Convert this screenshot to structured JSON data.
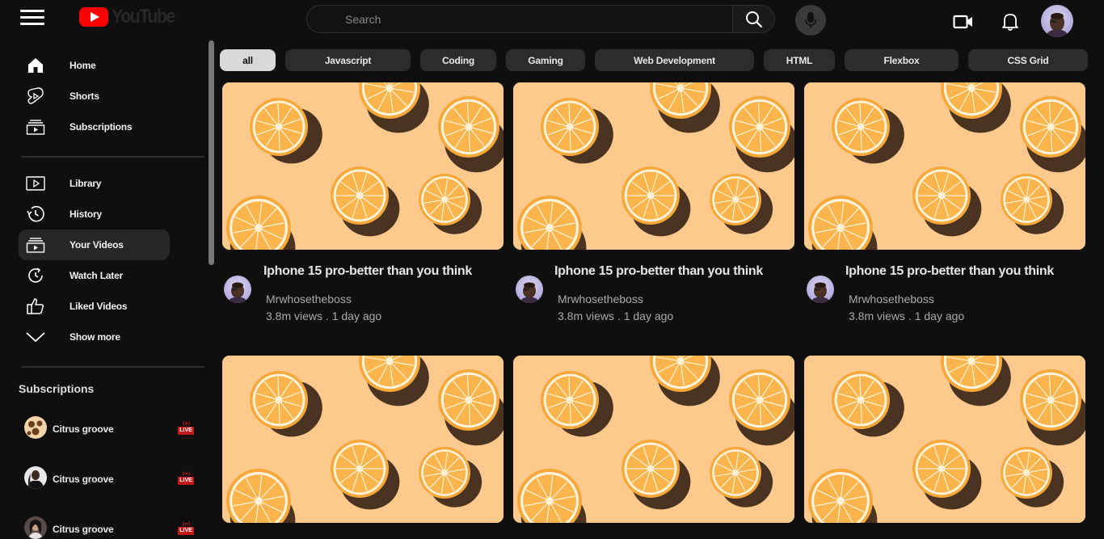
{
  "header": {
    "logo_text": "YouTube",
    "search_placeholder": "Search"
  },
  "sidebar": {
    "main_items": [
      {
        "label": "Home",
        "icon": "home-icon"
      },
      {
        "label": "Shorts",
        "icon": "shorts-icon"
      },
      {
        "label": "Subscriptions",
        "icon": "subscriptions-icon"
      }
    ],
    "library_items": [
      {
        "label": "Library",
        "icon": "library-icon"
      },
      {
        "label": "History",
        "icon": "history-icon"
      },
      {
        "label": "Your Videos",
        "icon": "your-videos-icon",
        "active": true
      },
      {
        "label": "Watch Later",
        "icon": "watch-later-icon"
      },
      {
        "label": "Liked Videos",
        "icon": "thumbs-up-icon"
      },
      {
        "label": "Show more",
        "icon": "chevron-down-icon"
      }
    ],
    "subscriptions_heading": "Subscriptions",
    "subscriptions": [
      {
        "name": "Citrus groove",
        "live": "LIVE"
      },
      {
        "name": "Citrus groove",
        "live": "LIVE"
      },
      {
        "name": "Citrus groove",
        "live": "LIVE"
      }
    ]
  },
  "chips": [
    "all",
    "Javascript",
    "Coding",
    "Gaming",
    "Web Development",
    "HTML",
    "Flexbox",
    "CSS Grid"
  ],
  "videos": [
    {
      "title": "Iphone 15 pro-better than you think",
      "channel": "Mrwhosetheboss",
      "meta": "3.8m views . 1 day ago"
    },
    {
      "title": "Iphone 15 pro-better than you think",
      "channel": "Mrwhosetheboss",
      "meta": "3.8m views . 1 day ago"
    },
    {
      "title": "Iphone 15 pro-better than you think",
      "channel": "Mrwhosetheboss",
      "meta": "3.8m views . 1 day ago"
    },
    {
      "title": "",
      "channel": "",
      "meta": ""
    },
    {
      "title": "",
      "channel": "",
      "meta": ""
    },
    {
      "title": "",
      "channel": "",
      "meta": ""
    }
  ],
  "colors": {
    "background": "#0f0f0f",
    "accent_red": "#ff0000",
    "thumbnail_bg": "#fdc98d",
    "chip_active": "#d9d9d9",
    "chip_inactive": "#2c2c2c"
  }
}
